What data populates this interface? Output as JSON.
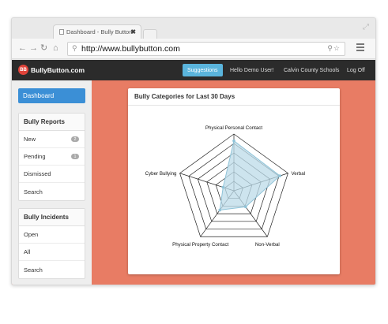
{
  "browser": {
    "tab_title": "Dashboard - Bully Button",
    "tab_close": "✖",
    "url": "http://www.bullybutton.com"
  },
  "app": {
    "logo_text": "BullyButton.com",
    "logo_mark": "BB",
    "nav": {
      "suggestions": "Suggestions",
      "greeting": "Hello Demo User!",
      "school": "Calvin County Schools",
      "logout": "Log Off"
    }
  },
  "sidebar": {
    "dashboard": "Dashboard",
    "reports": {
      "title": "Bully Reports",
      "items": [
        {
          "label": "New",
          "badge": "2"
        },
        {
          "label": "Pending",
          "badge": "1"
        },
        {
          "label": "Dismissed",
          "badge": ""
        },
        {
          "label": "Search",
          "badge": ""
        }
      ]
    },
    "incidents": {
      "title": "Bully Incidents",
      "items": [
        {
          "label": "Open"
        },
        {
          "label": "All"
        },
        {
          "label": "Search"
        }
      ]
    }
  },
  "chart": {
    "title": "Bully Categories for Last 30 Days"
  },
  "chart_data": {
    "type": "radar",
    "title": "Bully Categories for Last 30 Days",
    "categories": [
      "Physical Personal Contact",
      "Verbal",
      "Non-Verbal",
      "Physical Property Contact",
      "Cyber Bullying"
    ],
    "values": [
      0.88,
      0.85,
      0.35,
      0.42,
      0.2
    ],
    "rmax": 1,
    "rings": 6,
    "fill_color": "#bcdbe8",
    "stroke_color": "#8fc3d8"
  }
}
